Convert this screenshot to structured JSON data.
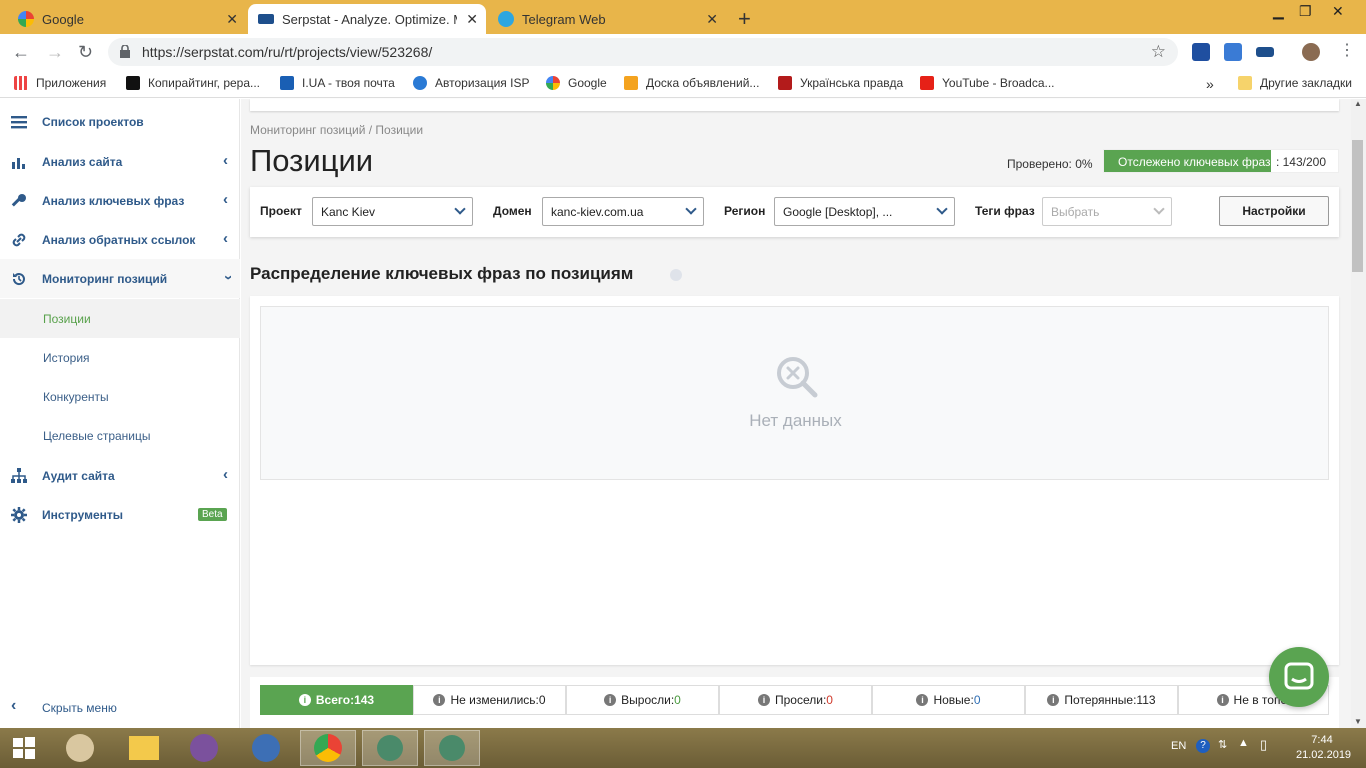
{
  "browser": {
    "tabs": [
      {
        "title": "Google"
      },
      {
        "title": "Serpstat - Analyze. Optimize. Ma"
      },
      {
        "title": "Telegram Web"
      }
    ],
    "url": "https://serpstat.com/ru/rt/projects/view/523268/",
    "bookmarks": [
      "Приложения",
      "Копирайтинг, рерa...",
      "I.UA - твоя почта",
      "Авторизация ISP",
      "Google",
      "Доска объявлений...",
      "Українська правда",
      "YouTube - Broadca..."
    ],
    "other_bookmarks": "Другие закладки"
  },
  "sidebar": {
    "items": [
      {
        "label": "Список проектов"
      },
      {
        "label": "Анализ сайта"
      },
      {
        "label": "Анализ ключевых фраз"
      },
      {
        "label": "Анализ обратных ссылок"
      },
      {
        "label": "Мониторинг позиций"
      }
    ],
    "subitems": [
      "Позиции",
      "История",
      "Конкуренты",
      "Целевые страницы"
    ],
    "audit": "Аудит сайта",
    "tools": "Инструменты",
    "beta": "Beta",
    "collapse": "Скрыть меню"
  },
  "main": {
    "breadcrumb": "Мониторинг позиций / Позиции",
    "title": "Позиции",
    "checked": "Проверено: 0%",
    "tracked_label": "Отслежено ключевых фраз",
    "tracked_count": ": 143/200",
    "tracked_fraction": 0.715,
    "filters": {
      "project_label": "Проект",
      "project_value": "Kanc Kiev",
      "domain_label": "Домен",
      "domain_value": "kanc-kiev.com.ua",
      "region_label": "Регион",
      "region_value": "Google [Desktop], ...",
      "tags_label": "Теги фраз",
      "tags_placeholder": "Выбрать",
      "settings": "Настройки"
    },
    "section_title": "Распределение ключевых фраз по позициям",
    "no_data": "Нет данных",
    "stats": [
      {
        "label": "Всего: ",
        "value": "143"
      },
      {
        "label": "Не изменились: ",
        "value": "0"
      },
      {
        "label": "Выросли: ",
        "value": "0"
      },
      {
        "label": "Просели: ",
        "value": "0"
      },
      {
        "label": "Новые: ",
        "value": "0"
      },
      {
        "label": "Потерянные: ",
        "value": "113"
      },
      {
        "label": "Не в топе: ",
        "value": ""
      }
    ]
  },
  "taskbar": {
    "lang": "EN",
    "time": "7:44",
    "date": "21.02.2019"
  },
  "colors": {
    "accent_green": "#5aa451",
    "link_blue": "#2f5a8a",
    "tabstrip": "#e8b54a"
  }
}
